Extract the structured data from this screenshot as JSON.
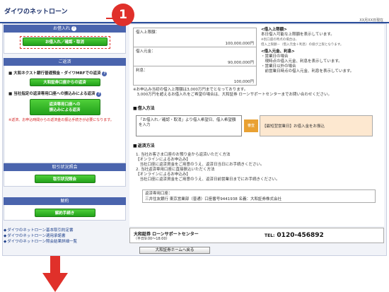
{
  "header": {
    "title": "ダイワのネットローン",
    "date": "XX月XX日現在"
  },
  "sidebar": {
    "loan_section": {
      "title": "お借入れ",
      "help": "?",
      "button": "お借入れ／確認・取消"
    },
    "repay_section": {
      "title": "ご返済",
      "item1_title": "大和ネクスト銀行普通預金・ダイワMRFでの返済",
      "item1_help": "?",
      "item1_button": "大和証券口座からの返済",
      "item2_title": "当社指定の返済専用口座への振込みによる返済",
      "item2_help": "?",
      "item2_button_line1": "返済専用口座への",
      "item2_button_line2": "振込みによる返済",
      "note": "※返済、お申込時間からの返済金の振込手続きが必要になります。"
    },
    "history_section": {
      "title": "取引状況照会",
      "button": "取引状況照会"
    },
    "cancel_section": {
      "title": "解約",
      "button": "解約手続き"
    }
  },
  "badge": {
    "number": "1"
  },
  "links": [
    "ダイワのネットローン基本取引約定書",
    "ダイワのネットローン適用承諾書",
    "ダイワのネットローン照会結果詳細一覧"
  ],
  "limits": {
    "rows": [
      {
        "label": "借入上限額：",
        "value": "100,000,000円"
      },
      {
        "label": "借入元金：",
        "value": "90,000,000円"
      },
      {
        "label": "利息：",
        "value": "100,000円"
      }
    ]
  },
  "info_panel": {
    "heading1": "<借入上限額>",
    "text1": "本日借入可能な上限額を表示しています。",
    "small1": "※別口座の時点の場合は、",
    "small2": "借入上限額－（借入元金＋利息）の値が上限となります。",
    "heading2": "<借入元金、利息>",
    "bullet1": "・営業日の場合",
    "text2": "　現時点の借入元金、利息を表示しています。",
    "bullet2": "・営業日以外の場合",
    "text3": "　前営業日時点の借入元金、利息を表示しています。"
  },
  "note_main": {
    "line1": "※お申込み当初の借入上限額は3,000万円までとなっております。",
    "line2": "　3,000万円を超えるお借入れをご希望の場合は、大和証券 ローンサポートセンターまでお問い合わせください。"
  },
  "borrow_method": {
    "title": "借入方法",
    "step1": "「お借入れ／確認・取消」より借入希望日、借入希望額を入力",
    "arrow": "審査",
    "step2": "【最短翌営業日】お借入金をお振込"
  },
  "repay_method": {
    "title": "返済方法",
    "line1": "1. 当社お客さま口座のお預り金から返済いただく方法",
    "line2": "【オンラインによるお申込み】",
    "line3": "　当社口座に返済資金をご用意のうえ、返済日当日にお手続きください。",
    "line4": "2. 当社返済専用口座に直接振込いただく方法",
    "line5": "【オンラインによるお申込み】",
    "line6": "　当社口座に返済資金をご用意のうえ、返済日前営業日までにお手続きください。",
    "account_label": "返済専用口座：",
    "account_value": "三井住友銀行 東京営業部（普通）口座番号9441938 名義：大和証券株式会社"
  },
  "support": {
    "name": "大和証券 ローンサポートセンター",
    "hours": "（平日9:00～18:00）",
    "tel_label": "TEL:",
    "tel": "0120-456892"
  },
  "home_button": "大和証券ホームへ戻る",
  "colors": {
    "accent": "#4a64ad",
    "button_green": "#22a11a",
    "badge_red": "#e0302a",
    "arrow_red": "#e0302a"
  }
}
